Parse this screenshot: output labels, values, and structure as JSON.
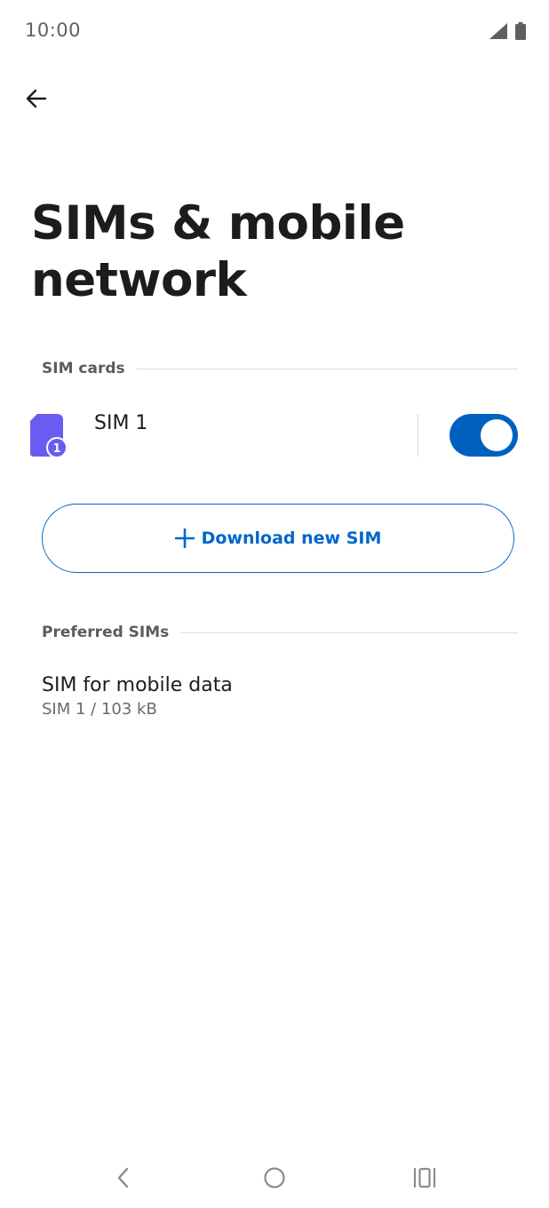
{
  "status_bar": {
    "time": "10:00",
    "icons": [
      "signal-icon",
      "battery-icon"
    ]
  },
  "header": {
    "back_icon": "arrow-left-icon",
    "title": "SIMs & mobile network"
  },
  "sections": {
    "sim_cards": {
      "label": "SIM cards",
      "sim": {
        "name": "SIM 1",
        "badge": "1",
        "enabled": true,
        "icon": "sim-card-icon"
      }
    },
    "download_button": {
      "label": "Download new SIM",
      "icon": "plus-icon"
    },
    "preferred_sims": {
      "label": "Preferred SIMs",
      "items": [
        {
          "title": "SIM for mobile data",
          "subtitle": "SIM 1 / 103 kB"
        }
      ]
    }
  },
  "nav_bar": {
    "buttons": [
      "back-nav-icon",
      "home-nav-icon",
      "recents-nav-icon"
    ]
  },
  "colors": {
    "accent": "#0066cc",
    "toggle_on": "#0060c0",
    "sim_icon": "#6a5cf0"
  }
}
